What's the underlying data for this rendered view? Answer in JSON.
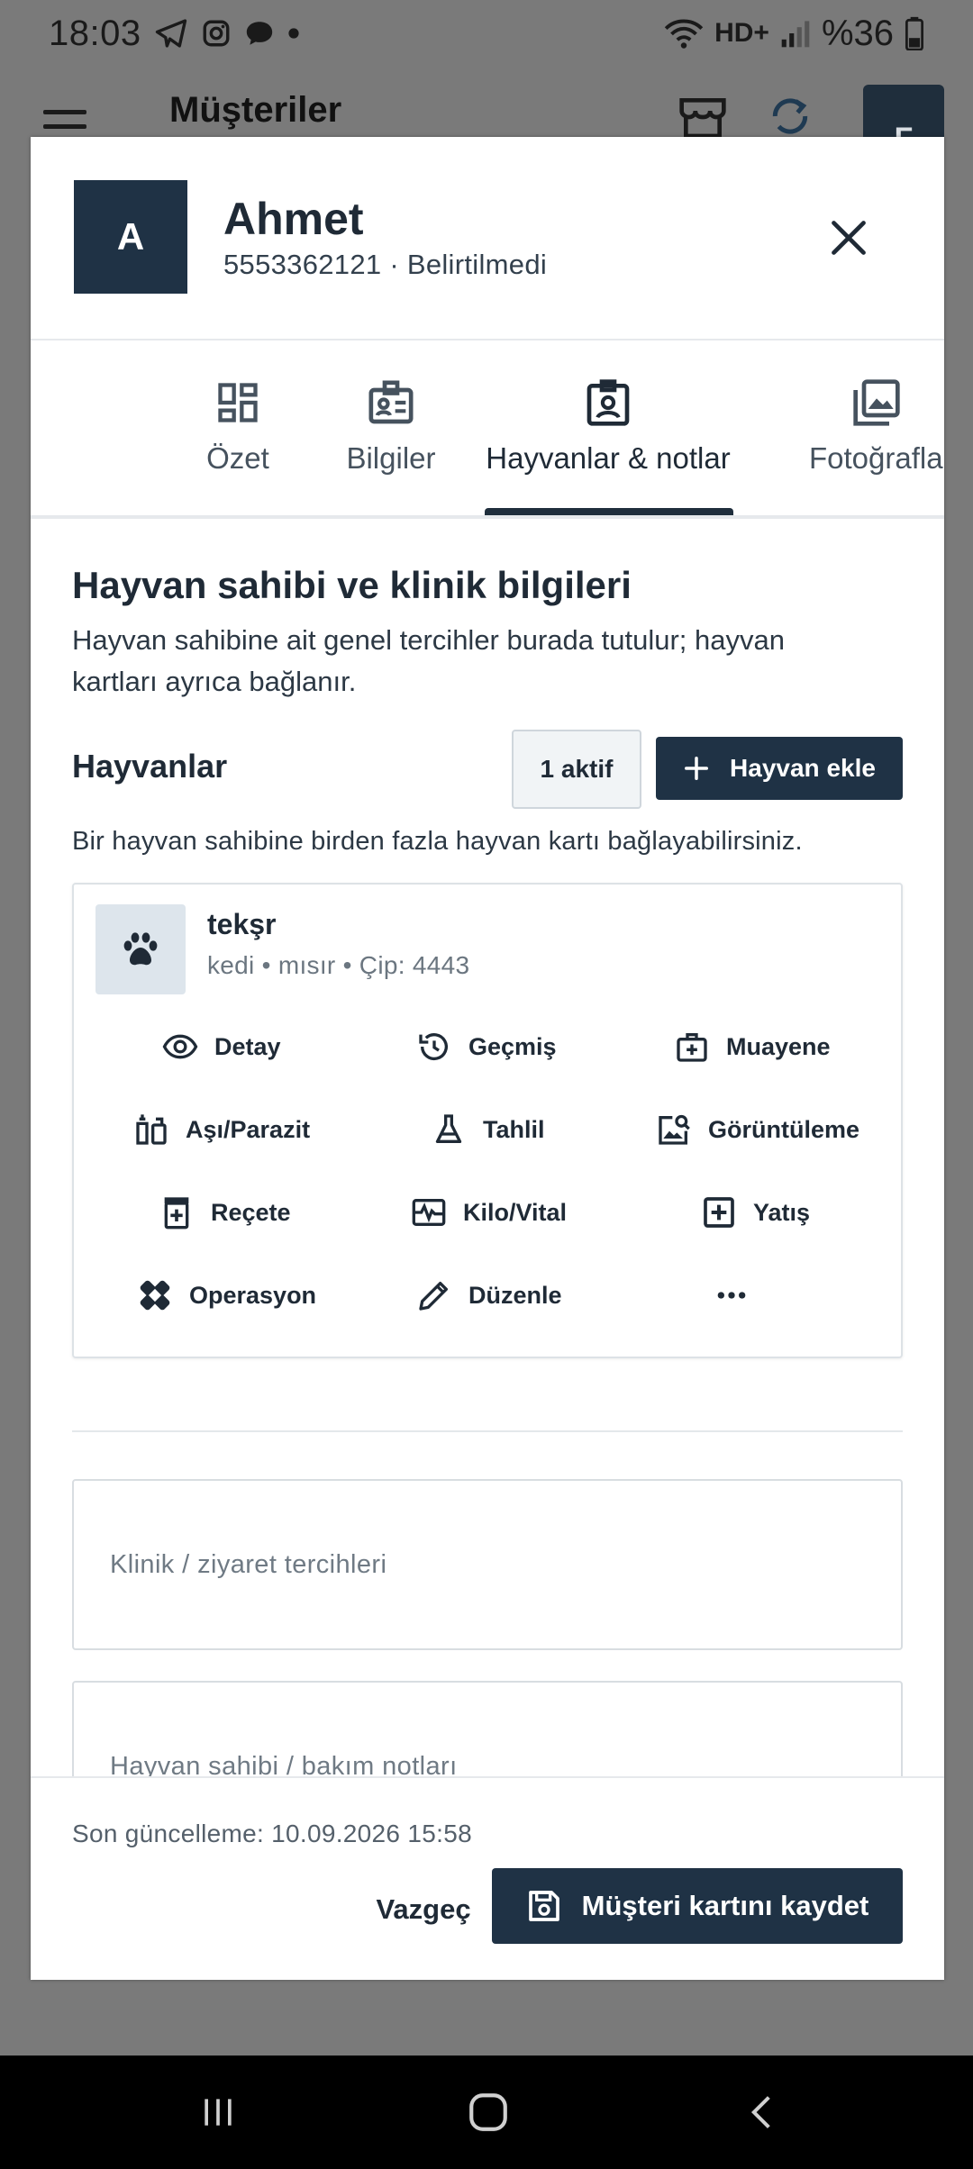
{
  "status_bar": {
    "time": "18:03",
    "battery": "%36",
    "network": "HD+"
  },
  "app_header": {
    "title": "Müşteriler",
    "avatar_letter": "F"
  },
  "dialog": {
    "avatar_letter": "A",
    "name": "Ahmet",
    "subtitle": "5553362121 · Belirtilmedi",
    "tabs": [
      {
        "label": "Özet",
        "icon": "dashboard-icon"
      },
      {
        "label": "Bilgiler",
        "icon": "id-card-icon"
      },
      {
        "label": "Hayvanlar & notlar",
        "icon": "badge-icon",
        "active": true
      },
      {
        "label": "Fotoğrafla",
        "icon": "photos-icon"
      }
    ],
    "section": {
      "title": "Hayvan sahibi ve klinik bilgileri",
      "description": "Hayvan sahibine ait genel tercihler burada tutulur; hayvan kartları ayrıca bağlanır."
    },
    "animals": {
      "title": "Hayvanlar",
      "active_badge": "1 aktif",
      "add_button": "Hayvan ekle",
      "hint": "Bir hayvan sahibine birden fazla hayvan kartı bağlayabilirsiniz."
    },
    "pet": {
      "name": "tekşr",
      "meta": "kedi • mısır • Çip: 4443",
      "actions": [
        {
          "label": "Detay",
          "icon": "eye-icon"
        },
        {
          "label": "Geçmiş",
          "icon": "history-icon"
        },
        {
          "label": "Muayene",
          "icon": "medical-bag-icon"
        },
        {
          "label": "Aşı/Parazit",
          "icon": "vaccine-icon"
        },
        {
          "label": "Tahlil",
          "icon": "flask-icon"
        },
        {
          "label": "Görüntüleme",
          "icon": "image-search-icon"
        },
        {
          "label": "Reçete",
          "icon": "prescription-icon"
        },
        {
          "label": "Kilo/Vital",
          "icon": "vital-signs-icon"
        },
        {
          "label": "Yatış",
          "icon": "plus-box-icon"
        },
        {
          "label": "Operasyon",
          "icon": "bandage-icon"
        },
        {
          "label": "Düzenle",
          "icon": "pencil-icon"
        },
        {
          "label": "",
          "icon": "more-horizontal-icon"
        }
      ]
    },
    "fields": {
      "clinic_placeholder": "Klinik / ziyaret tercihleri",
      "owner_notes_placeholder": "Hayvan sahibi / bakım notları"
    },
    "footer": {
      "updated": "Son güncelleme: 10.09.2026 15:58",
      "cancel": "Vazgeç",
      "save": "Müşteri kartını kaydet"
    }
  }
}
